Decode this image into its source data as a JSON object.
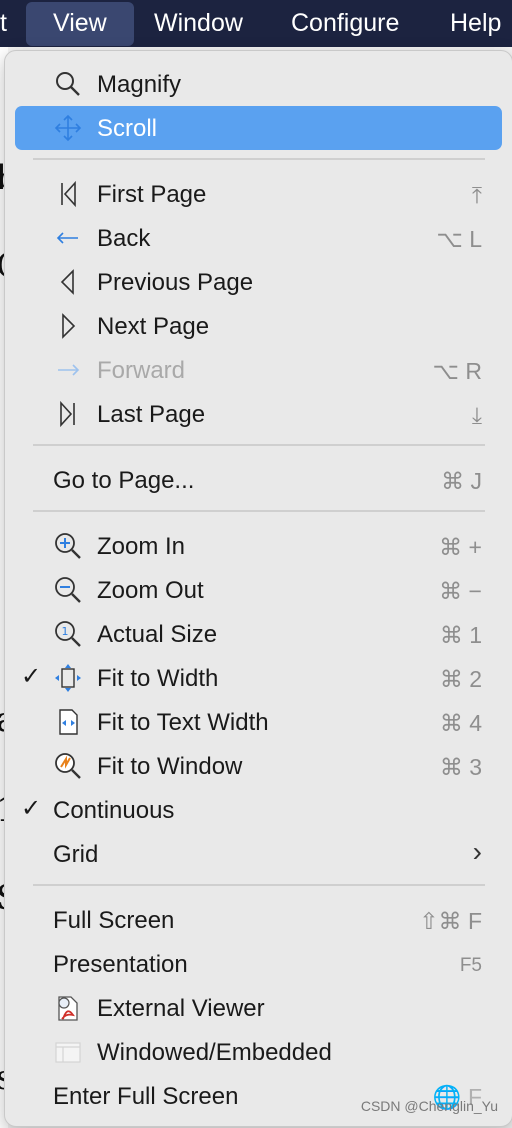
{
  "menubar": {
    "items": [
      "t",
      "View",
      "Window",
      "Configure",
      "Help"
    ],
    "selected": "View"
  },
  "background_text": [
    "b",
    "C",
    "a",
    "1",
    "S",
    "s"
  ],
  "menu": {
    "magnify": {
      "label": "Magnify",
      "icon": "magnify-icon"
    },
    "scroll": {
      "label": "Scroll",
      "icon": "scroll-arrows-icon",
      "highlighted": true
    },
    "first_page": {
      "label": "First Page",
      "shortcut": "⤒",
      "icon": "first-page-icon"
    },
    "back": {
      "label": "Back",
      "shortcut": "⌥ L",
      "icon": "back-arrow-icon"
    },
    "previous_page": {
      "label": "Previous Page",
      "icon": "previous-page-icon"
    },
    "next_page": {
      "label": "Next Page",
      "icon": "next-page-icon"
    },
    "forward": {
      "label": "Forward",
      "shortcut": "⌥ R",
      "icon": "forward-arrow-icon",
      "disabled": true
    },
    "last_page": {
      "label": "Last Page",
      "shortcut": "⤓",
      "icon": "last-page-icon"
    },
    "go_to_page": {
      "label": "Go to Page...",
      "shortcut": "⌘ J"
    },
    "zoom_in": {
      "label": "Zoom In",
      "shortcut": "⌘ +",
      "icon": "zoom-in-icon"
    },
    "zoom_out": {
      "label": "Zoom Out",
      "shortcut": "⌘ −",
      "icon": "zoom-out-icon"
    },
    "actual_size": {
      "label": "Actual Size",
      "shortcut": "⌘ 1",
      "icon": "actual-size-icon"
    },
    "fit_width": {
      "label": "Fit to Width",
      "shortcut": "⌘ 2",
      "icon": "fit-width-icon",
      "checked": true
    },
    "fit_text_width": {
      "label": "Fit to Text Width",
      "shortcut": "⌘ 4",
      "icon": "fit-text-width-icon"
    },
    "fit_window": {
      "label": "Fit to Window",
      "shortcut": "⌘ 3",
      "icon": "fit-window-icon"
    },
    "continuous": {
      "label": "Continuous",
      "checked": true
    },
    "grid": {
      "label": "Grid",
      "submenu_arrow": "›"
    },
    "full_screen": {
      "label": "Full Screen",
      "shortcut": "⇧⌘ F"
    },
    "presentation": {
      "label": "Presentation",
      "shortcut": "F5"
    },
    "external_viewer": {
      "label": "External Viewer",
      "icon": "pdf-viewer-icon"
    },
    "windowed": {
      "label": "Windowed/Embedded",
      "icon": "window-icon"
    },
    "enter_full_screen": {
      "label": "Enter Full Screen",
      "shortcut": "🌐 F"
    }
  },
  "checkmark": "✓",
  "watermark": "CSDN @Chenglin_Yu",
  "colors": {
    "highlight": "#5aa1f0",
    "menubar": "#1c2340",
    "icon_blue": "#2f7fe0",
    "shortcut_gray": "#8e8e8e"
  }
}
